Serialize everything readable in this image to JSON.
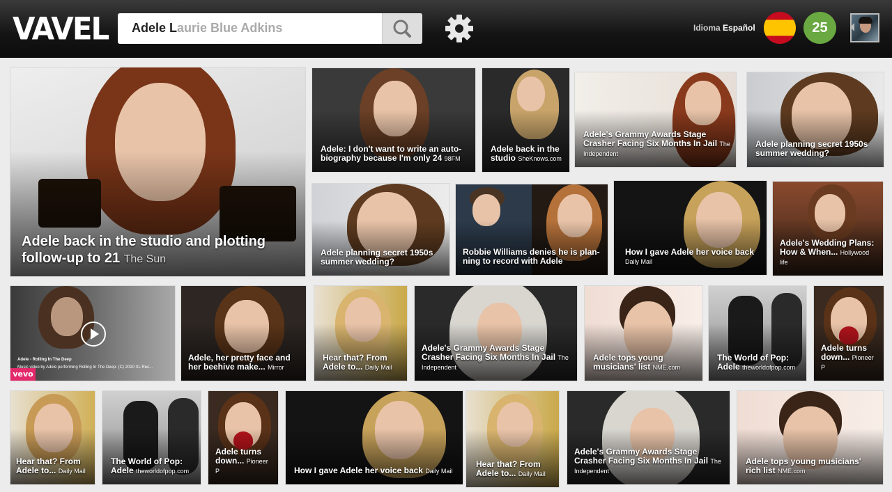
{
  "header": {
    "logo": "VAVEL",
    "search_typed": "Adele L",
    "search_hint": "aurie Blue Adkins",
    "language_label": "Idioma",
    "language_value": "Español",
    "notification_count": "25"
  },
  "tiles": [
    {
      "title": "Adele back in the studio and plotting follow-up to 21",
      "source": "The Sun"
    },
    {
      "title": "Adele: I don't want to write an auto-biography because I'm only 24",
      "source": "98FM"
    },
    {
      "title": "Adele back in the studio",
      "source": "SheKnows.com"
    },
    {
      "title": "Adele's Grammy Awards Stage Crasher Facing Six Months In Jail",
      "source": "The Independent"
    },
    {
      "title": "Adele planning secret 1950s summer wedding?",
      "source": ""
    },
    {
      "title": "Adele planning secret 1950s summer wedding?",
      "source": ""
    },
    {
      "title": "Robbie Williams denies he is plan-ning to record with Adele",
      "source": ""
    },
    {
      "title": "How I gave Adele her voice back",
      "source": "Daily Mail"
    },
    {
      "title": "Adele's Wedding Plans: How & When...",
      "source": "Hollywood life"
    },
    {
      "title": "",
      "source": ""
    },
    {
      "title": "Adele, her pretty face and her beehive make...",
      "source": "Mirror"
    },
    {
      "title": "Hear that? From Adele to...",
      "source": "Daily Mail"
    },
    {
      "title": "Adele's Grammy Awards Stage Crasher Facing Six Months In Jail",
      "source": "The Independent"
    },
    {
      "title": "Adele tops young musicians' list",
      "source": "NME.com"
    },
    {
      "title": "The World of Pop: Adele",
      "source": "theworldofpop.com"
    },
    {
      "title": "Adele turns down...",
      "source": "Pioneer P"
    },
    {
      "title": "Hear that? From Adele to...",
      "source": "Daily Mail"
    },
    {
      "title": "The World of Pop: Adele",
      "source": "theworldofpop.com"
    },
    {
      "title": "Adele turns down...",
      "source": "Pioneer P"
    },
    {
      "title": "How I gave Adele her voice back",
      "source": "Daily Mail"
    },
    {
      "title": "Hear that? From Adele to...",
      "source": "Daily Mail"
    },
    {
      "title": "Adele's Grammy Awards Stage Crasher Facing Six Months In Jail",
      "source": "The Independent"
    },
    {
      "title": "Adele tops young musicians' rich list",
      "source": "NME.com"
    }
  ],
  "video": {
    "title": "Adele - Rolling In The Deep",
    "description": "Music video by Adele performing Rolling In The Deep. (C) 2010 XL Rec...",
    "logo": "vevo"
  }
}
